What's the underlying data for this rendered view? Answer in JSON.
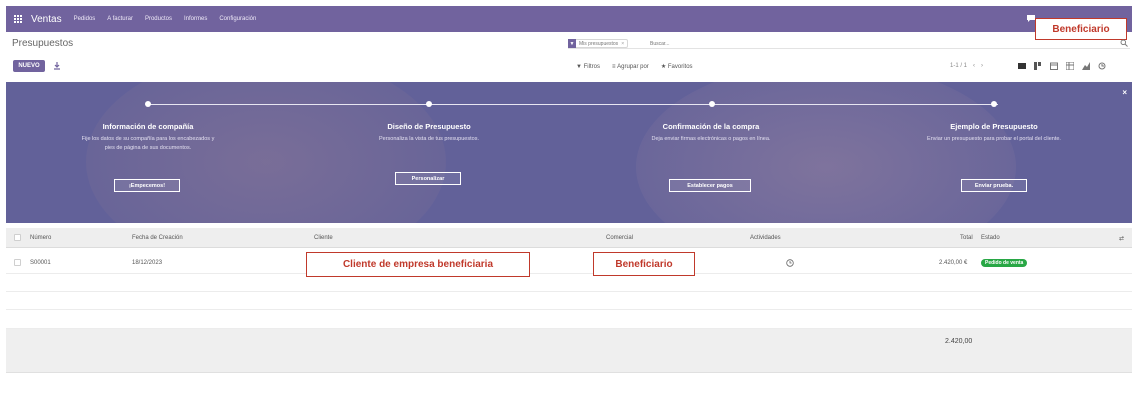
{
  "topbar": {
    "app_name": "Ventas",
    "menu": [
      "Pedidos",
      "A facturar",
      "Productos",
      "Informes",
      "Configuración"
    ],
    "icons": [
      "apps-icon",
      "chat-icon"
    ],
    "accent_color": "#71639e"
  },
  "annotations": {
    "top": "Beneficiario",
    "client": "Cliente de empresa beneficiaria",
    "salesperson": "Beneficiario",
    "color": "#c0392b"
  },
  "control_panel": {
    "breadcrumb": "Presupuestos",
    "new_button": "NUEVO",
    "search": {
      "facet": "Mis presupuestos",
      "facet_remove": "×",
      "placeholder": "Buscar..."
    },
    "filters": "Filtros",
    "group_by": "Agrupar por",
    "favorites": "Favoritos",
    "pager": "1-1 / 1"
  },
  "banner": {
    "close": "×",
    "steps": [
      {
        "title": "Información de compañía",
        "desc": "Fije los datos de su compañía para los encabezados y pies de página de sus documentos.",
        "button": "¡Empecemos!"
      },
      {
        "title": "Diseño de Presupuesto",
        "desc": "Personaliza la vista de tus presupuestos.",
        "button": "Personalizar"
      },
      {
        "title": "Confirmación de la compra",
        "desc": "Deja enviar firmas electrónicas o pagos en línea.",
        "button": "Establecer pagos"
      },
      {
        "title": "Ejemplo de Presupuesto",
        "desc": "Enviar un presupuesto para probar el portal del cliente.",
        "button": "Enviar prueba."
      }
    ]
  },
  "table": {
    "columns": [
      "Número",
      "Fecha de Creación",
      "Cliente",
      "Comercial",
      "Actividades",
      "Total",
      "Estado"
    ],
    "rows": [
      {
        "number": "S00001",
        "date": "18/12/2023",
        "customer": "",
        "salesperson": "",
        "total": "2.420,00 €",
        "status": "Pedido de venta"
      }
    ],
    "footer_total": "2.420,00",
    "status_color": "#28a745"
  }
}
